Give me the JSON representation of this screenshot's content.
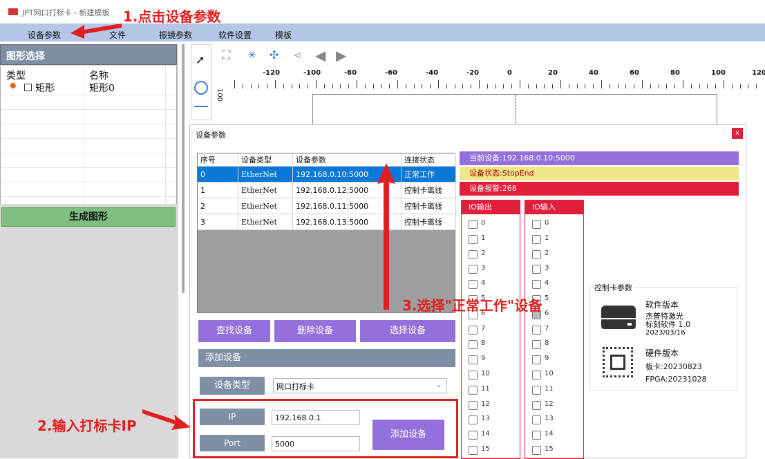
{
  "app": {
    "title": "JPT网口打标卡 - 新建模板"
  },
  "menu": [
    "设备参数",
    "文件",
    "振镜参数",
    "软件设置",
    "模板"
  ],
  "left_panel": {
    "header": "图形选择",
    "col_type": "类型",
    "col_name": "名称",
    "row": {
      "type": "矩形",
      "name": "矩形0"
    },
    "generate_button": "生成图形"
  },
  "ruler": {
    "ticks": [
      "-120",
      "-100",
      "-80",
      "-60",
      "-40",
      "-20",
      "0",
      "20",
      "40",
      "60",
      "80",
      "100",
      "120"
    ],
    "v_label": "100"
  },
  "dialog": {
    "title": "设备参数",
    "close": "x",
    "table": {
      "headers": [
        "序号",
        "设备类型",
        "设备参数",
        "连接状态"
      ],
      "rows": [
        [
          "0",
          "EtherNet",
          "192.168.0.10:5000",
          "正常工作"
        ],
        [
          "1",
          "EtherNet",
          "192.168.0.12:5000",
          "控制卡离线"
        ],
        [
          "2",
          "EtherNet",
          "192.168.0.11:5000",
          "控制卡离线"
        ],
        [
          "3",
          "EtherNet",
          "192.168.0.13:5000",
          "控制卡离线"
        ]
      ]
    },
    "buttons": {
      "find": "查找设备",
      "delete": "删除设备",
      "select": "选择设备",
      "add": "添加设备"
    },
    "add_section": "添加设备",
    "device_type_label": "设备类型",
    "device_type_value": "网口打标卡",
    "ip_label": "IP",
    "ip_value": "192.168.0.1",
    "port_label": "Port",
    "port_value": "5000",
    "status": {
      "current": "当前设备:192.168.0.10:5000",
      "state": "设备状态:StopEnd",
      "alarm": "设备报警:268"
    },
    "io_out_header": "IO输出",
    "io_in_header": "IO输入",
    "io_numbers": [
      "0",
      "1",
      "2",
      "3",
      "4",
      "5",
      "6",
      "7",
      "8",
      "9",
      "10",
      "11",
      "12",
      "13",
      "14",
      "15"
    ],
    "card": {
      "section": "控制卡参数",
      "sw_title": "软件版本",
      "sw_name": "杰普特激光\n标刻软件 1.0",
      "sw_date": "2023/03/16",
      "hw_title": "硬件版本",
      "board": "板卡:20230823",
      "fpga": "FPGA:20231028"
    }
  },
  "annotations": {
    "step1": "1.点击设备参数",
    "step2": "2.输入打标卡IP",
    "step3": "3.选择\"正常工作\"设备"
  },
  "colors": {
    "menubar": "#b4c7e7",
    "accent": "#9370db",
    "selected": "#0a78d7",
    "alarm": "#e0203a",
    "annotation": "#e02020"
  }
}
